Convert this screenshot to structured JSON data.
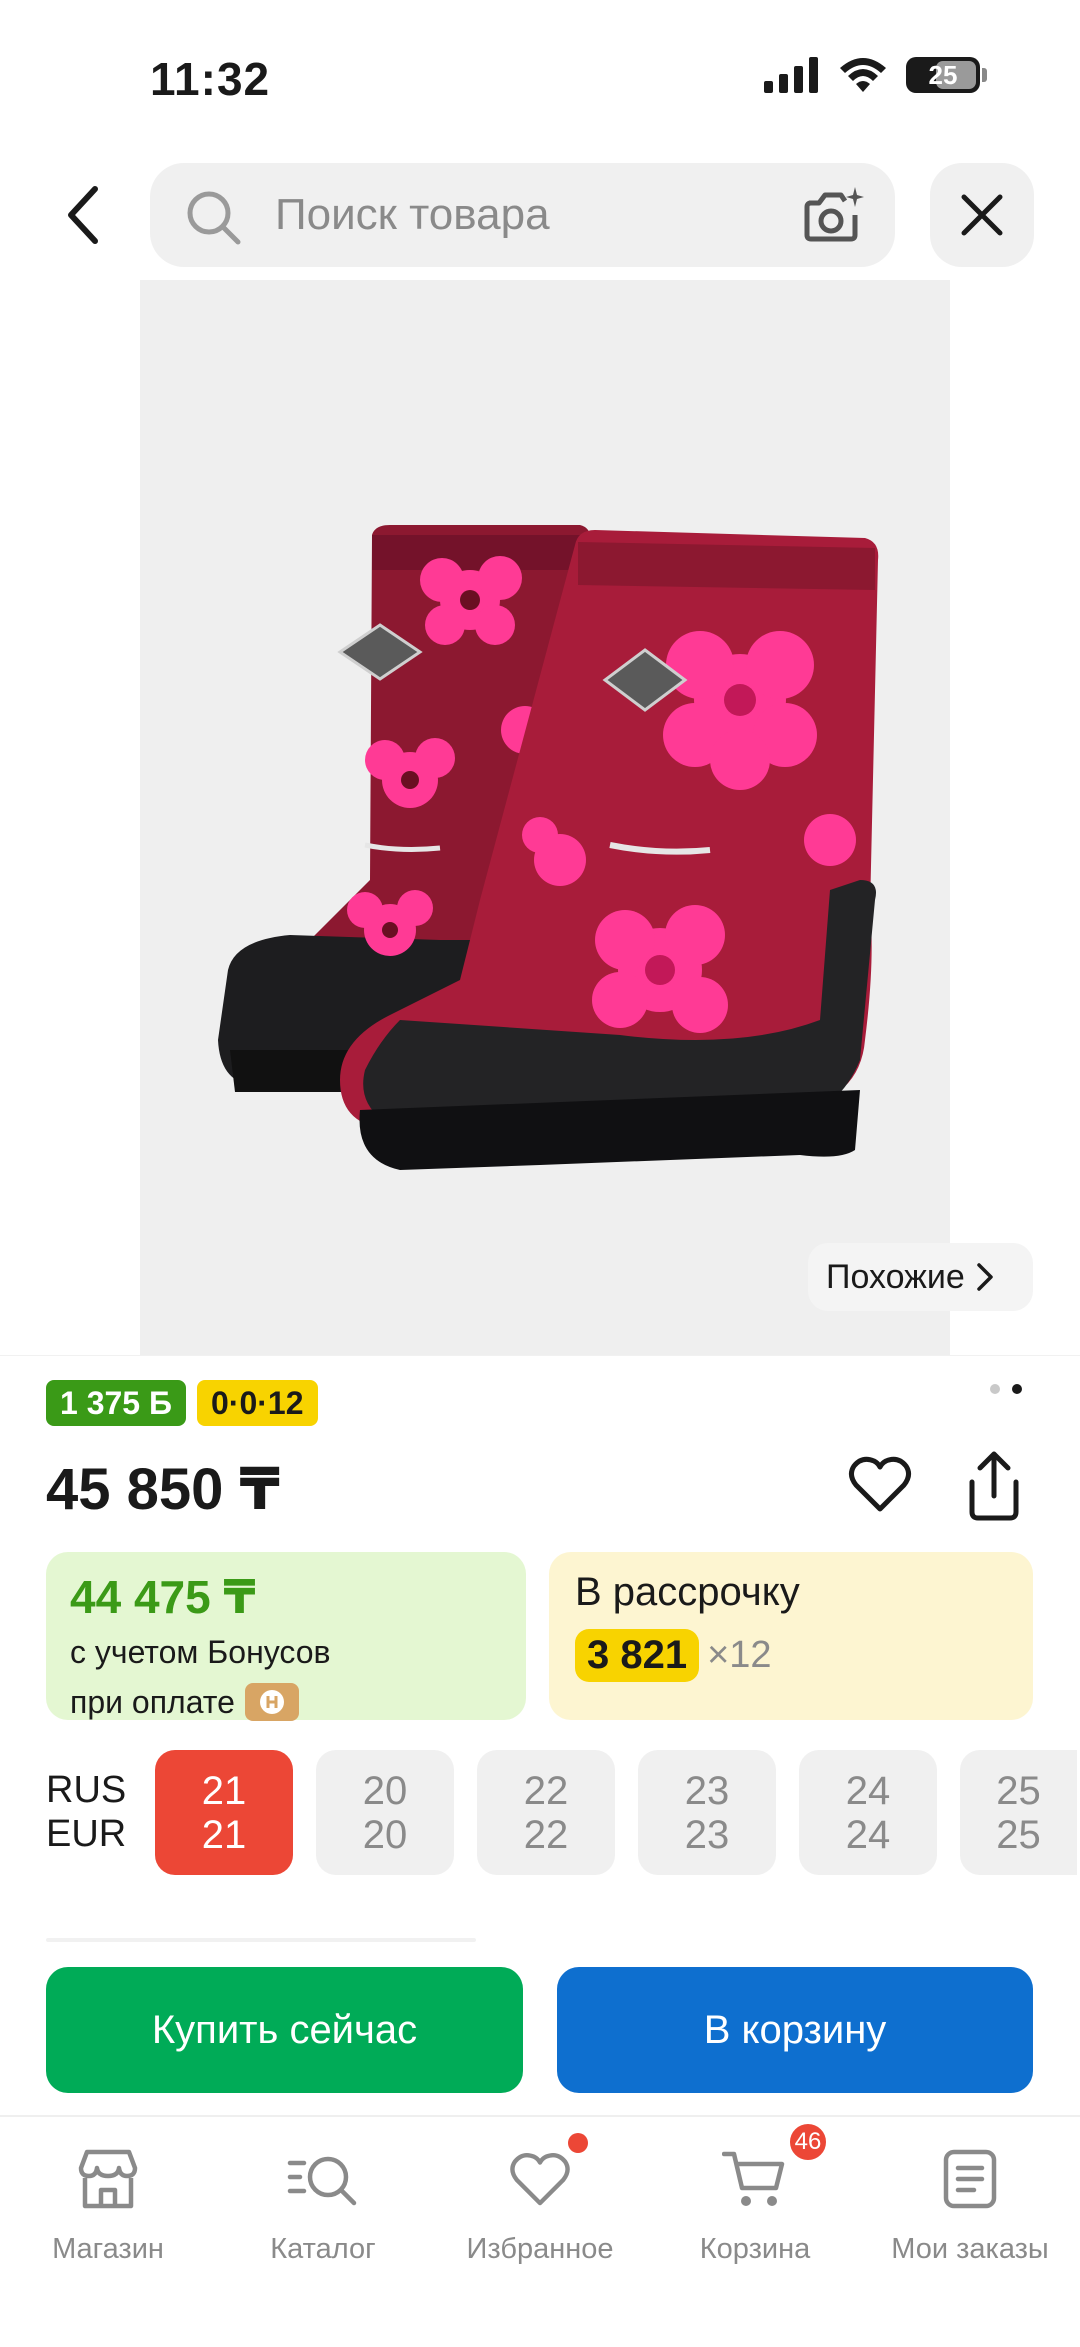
{
  "status_bar": {
    "time": "11:32",
    "battery": "25"
  },
  "search": {
    "placeholder": "Поиск товара"
  },
  "similar": {
    "label": "Похожие"
  },
  "badges": {
    "bonus": "1 375 Б",
    "installment": "0·0·12"
  },
  "price": "45 850 ₸",
  "bonus_card": {
    "price": "44 475 ₸",
    "line1": "с учетом Бонусов",
    "line2": "при оплате"
  },
  "installment_card": {
    "title": "В рассрочку",
    "amount": "3 821",
    "months": "×12"
  },
  "sizes": {
    "labels": [
      "RUS",
      "EUR"
    ],
    "items": [
      {
        "rus": "21",
        "eur": "21",
        "selected": true
      },
      {
        "rus": "20",
        "eur": "20",
        "selected": false
      },
      {
        "rus": "22",
        "eur": "22",
        "selected": false
      },
      {
        "rus": "23",
        "eur": "23",
        "selected": false
      },
      {
        "rus": "24",
        "eur": "24",
        "selected": false
      },
      {
        "rus": "25",
        "eur": "25",
        "selected": false
      }
    ]
  },
  "actions": {
    "buy_now": "Купить сейчас",
    "add_to_cart": "В корзину"
  },
  "nav": {
    "items": [
      {
        "label": "Магазин",
        "icon": "store-icon"
      },
      {
        "label": "Каталог",
        "icon": "catalog-search-icon"
      },
      {
        "label": "Избранное",
        "icon": "heart-icon"
      },
      {
        "label": "Корзина",
        "icon": "cart-icon",
        "badge": "46"
      },
      {
        "label": "Мои заказы",
        "icon": "orders-icon"
      }
    ]
  },
  "colors": {
    "green": "#00ab57",
    "blue": "#0e6fcf",
    "red": "#ec4736",
    "yellow": "#f8d300"
  }
}
